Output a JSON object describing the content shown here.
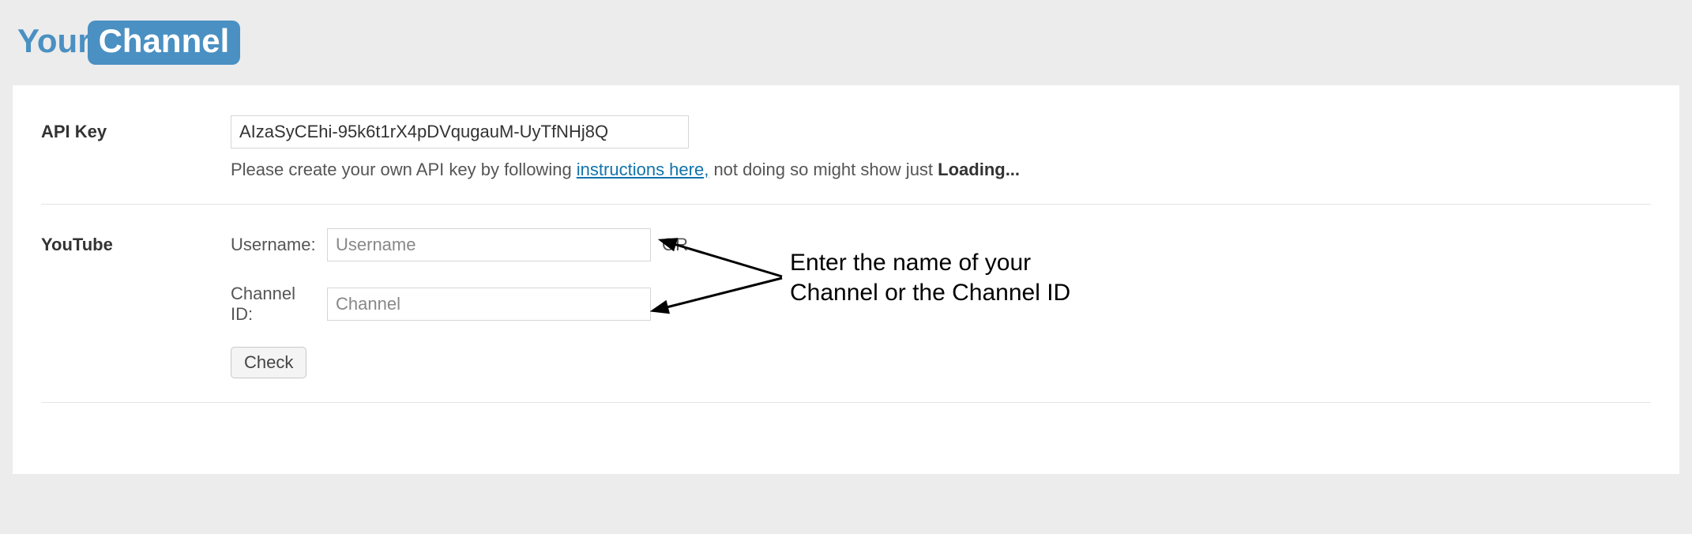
{
  "logo": {
    "part1": "Your",
    "part2": "Channel"
  },
  "apikey": {
    "label": "API Key",
    "value": "AIzaSyCEhi-95k6t1rX4pDVqugauM-UyTfNHj8Q",
    "help_before": "Please create your own API key by following ",
    "help_link": "instructions here,",
    "help_after": " not doing so might show just ",
    "help_strong": "Loading..."
  },
  "youtube": {
    "label": "YouTube",
    "username_label": "Username:",
    "username_placeholder": "Username",
    "or": "OR",
    "channel_label": "Channel ID:",
    "channel_placeholder": "Channel",
    "check": "Check"
  },
  "annotation": {
    "line1": "Enter the name of your",
    "line2": "Channel or the Channel ID"
  }
}
